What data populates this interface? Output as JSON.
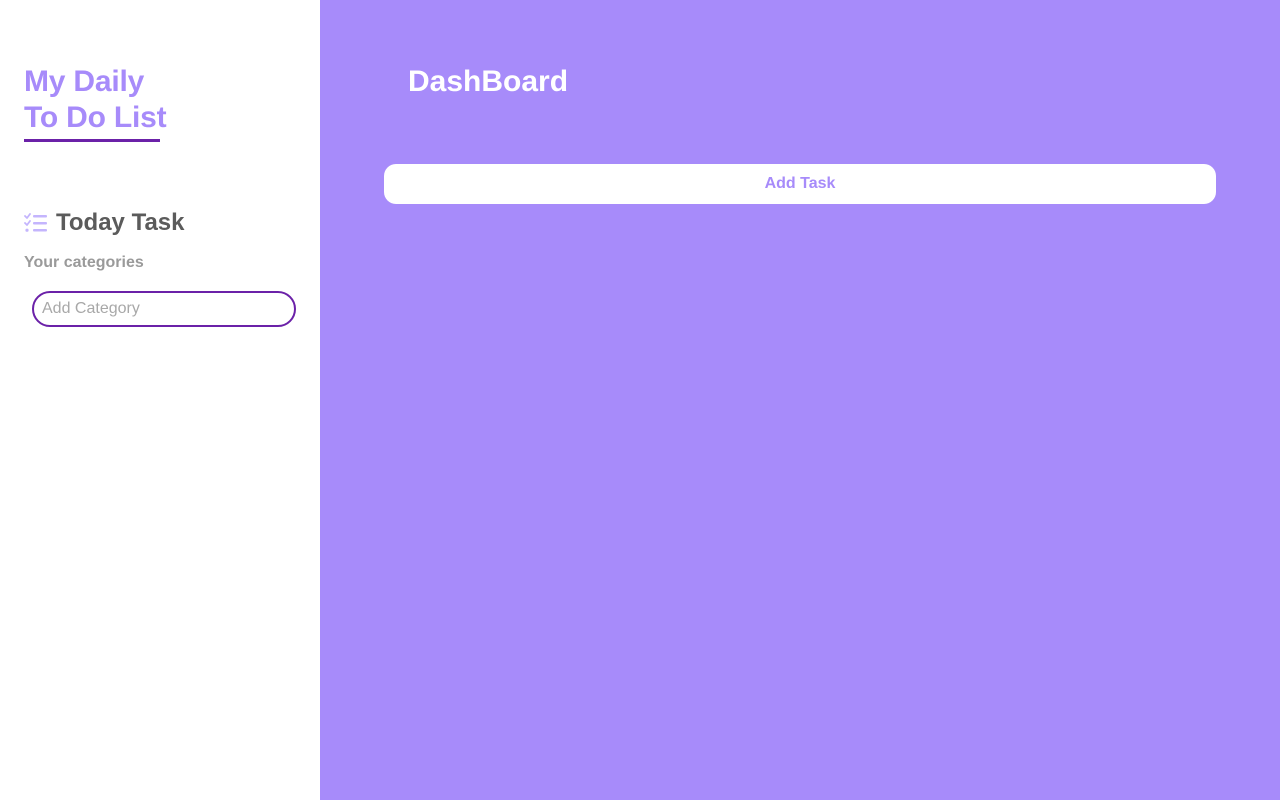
{
  "sidebar": {
    "brand_line1": "My Daily",
    "brand_line2": "To Do List",
    "section_title": "Today Task",
    "section_icon": "checklist-icon",
    "categories_label": "Your categories",
    "category_input": {
      "value": "",
      "placeholder": "Add Category"
    }
  },
  "main": {
    "title": "DashBoard",
    "add_task_label": "Add Task"
  },
  "colors": {
    "accent": "#a78bfa",
    "accent_dark": "#6b21a8",
    "text_dark": "#5b5b5b",
    "text_muted": "#9a9a9a",
    "panel_bg": "#ffffff"
  }
}
